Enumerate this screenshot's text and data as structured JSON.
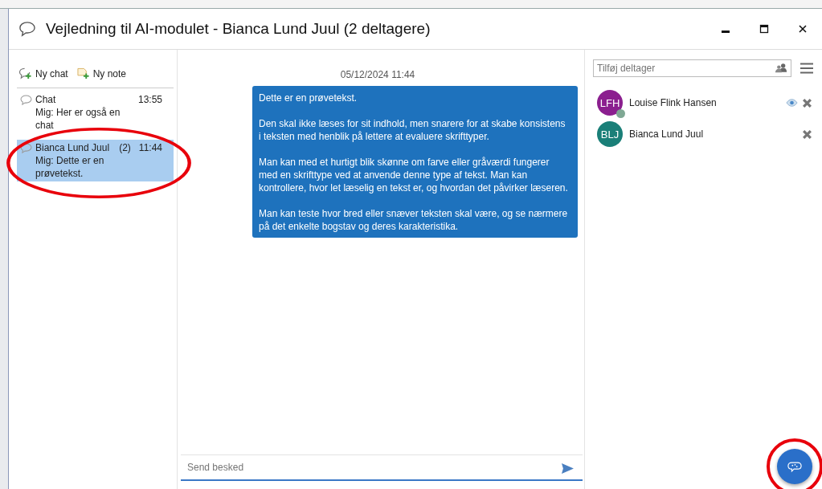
{
  "window": {
    "title": "Vejledning til AI-modulet - Bianca Lund Juul (2 deltagere)"
  },
  "actions": [
    {
      "kind": "chat",
      "label": "Ny chat"
    },
    {
      "kind": "note",
      "label": "Ny note"
    }
  ],
  "chats": [
    {
      "name": "Chat",
      "time": "13:55",
      "preview": "Mig: Her er også en chat",
      "selected": false,
      "circled": false
    },
    {
      "name": "Bianca Lund Juul",
      "count": "(2)",
      "time": "11:44",
      "preview": "Mig: Dette er en prøvetekst.",
      "selected": true,
      "circled": true
    }
  ],
  "conversation": {
    "date": "05/12/2024 11:44",
    "message": [
      "Dette er en prøvetekst.",
      "Den skal ikke læses for sit indhold, men snarere for at skabe konsistens i teksten med henblik på lettere at evaluere skrifttyper.",
      "Man kan med et hurtigt blik skønne om farve eller gråværdi fungerer med en skrifttype ved at anvende denne type af tekst. Man kan kontrollere, hvor let læselig en tekst er, og hvordan det påvirker læseren.",
      "Man kan teste hvor bred eller snæver teksten skal være, og se nærmere på det enkelte bogstav og deres karakteristika."
    ]
  },
  "composer": {
    "placeholder": "Send besked"
  },
  "participants_search": {
    "placeholder": "Tilføj deltager"
  },
  "participants": [
    {
      "initials": "LFH",
      "name": "Louise Flink Hansen",
      "color": "#8b1f8f",
      "online": true,
      "watching": true
    },
    {
      "initials": "BLJ",
      "name": "Bianca Lund Juul",
      "color": "#1a7f78",
      "online": false,
      "watching": false
    }
  ],
  "ai_button": {
    "circled": true
  }
}
